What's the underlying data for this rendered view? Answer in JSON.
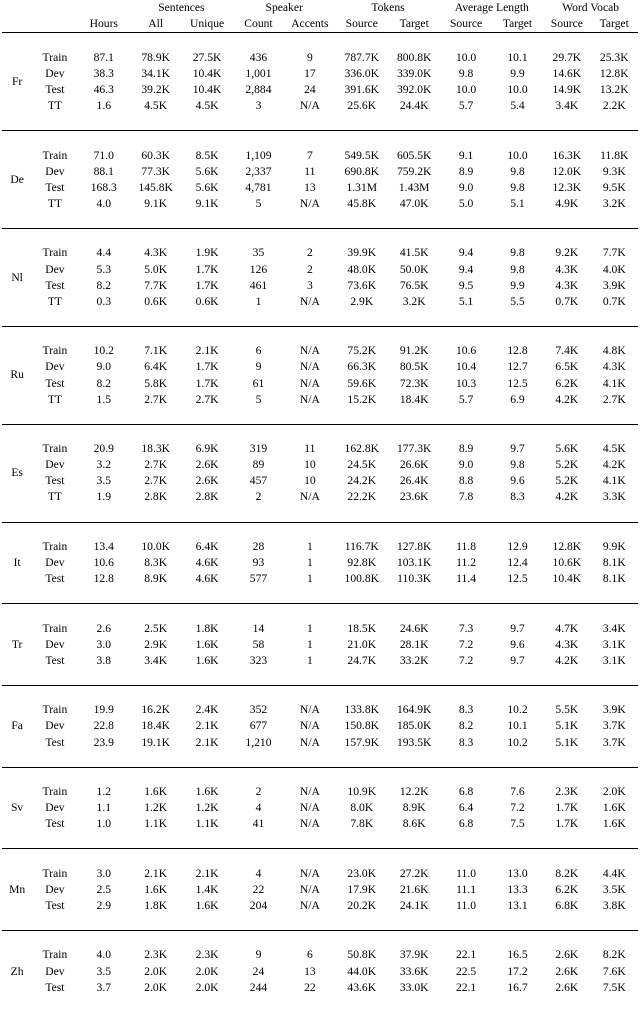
{
  "table": {
    "caption": "",
    "group_headers": [
      {
        "label": "",
        "span": 2
      },
      {
        "label": "",
        "span": 1
      },
      {
        "label": "Sentences",
        "span": 2
      },
      {
        "label": "Speaker",
        "span": 2
      },
      {
        "label": "Tokens",
        "span": 2
      },
      {
        "label": "Average Length",
        "span": 2
      },
      {
        "label": "Word Vocab",
        "span": 2
      }
    ],
    "sub_headers": [
      "",
      "",
      "Hours",
      "All",
      "Unique",
      "Count",
      "Accents",
      "Source",
      "Target",
      "Source",
      "Target",
      "Source",
      "Target"
    ],
    "groups": [
      {
        "lang": "Fr",
        "rows": [
          {
            "split": "Train",
            "hours": "87.1",
            "sent_all": "78.9K",
            "sent_uniq": "27.5K",
            "spk_count": "436",
            "spk_accents": "9",
            "tok_src": "787.7K",
            "tok_tgt": "800.8K",
            "avg_src": "10.0",
            "avg_tgt": "10.1",
            "voc_src": "29.7K",
            "voc_tgt": "25.3K"
          },
          {
            "split": "Dev",
            "hours": "38.3",
            "sent_all": "34.1K",
            "sent_uniq": "10.4K",
            "spk_count": "1,001",
            "spk_accents": "17",
            "tok_src": "336.0K",
            "tok_tgt": "339.0K",
            "avg_src": "9.8",
            "avg_tgt": "9.9",
            "voc_src": "14.6K",
            "voc_tgt": "12.8K"
          },
          {
            "split": "Test",
            "hours": "46.3",
            "sent_all": "39.2K",
            "sent_uniq": "10.4K",
            "spk_count": "2,884",
            "spk_accents": "24",
            "tok_src": "391.6K",
            "tok_tgt": "392.0K",
            "avg_src": "10.0",
            "avg_tgt": "10.0",
            "voc_src": "14.9K",
            "voc_tgt": "13.2K"
          },
          {
            "split": "TT",
            "hours": "1.6",
            "sent_all": "4.5K",
            "sent_uniq": "4.5K",
            "spk_count": "3",
            "spk_accents": "N/A",
            "tok_src": "25.6K",
            "tok_tgt": "24.4K",
            "avg_src": "5.7",
            "avg_tgt": "5.4",
            "voc_src": "3.4K",
            "voc_tgt": "2.2K"
          }
        ]
      },
      {
        "lang": "De",
        "rows": [
          {
            "split": "Train",
            "hours": "71.0",
            "sent_all": "60.3K",
            "sent_uniq": "8.5K",
            "spk_count": "1,109",
            "spk_accents": "7",
            "tok_src": "549.5K",
            "tok_tgt": "605.5K",
            "avg_src": "9.1",
            "avg_tgt": "10.0",
            "voc_src": "16.3K",
            "voc_tgt": "11.8K"
          },
          {
            "split": "Dev",
            "hours": "88.1",
            "sent_all": "77.3K",
            "sent_uniq": "5.6K",
            "spk_count": "2,337",
            "spk_accents": "11",
            "tok_src": "690.8K",
            "tok_tgt": "759.2K",
            "avg_src": "8.9",
            "avg_tgt": "9.8",
            "voc_src": "12.0K",
            "voc_tgt": "9.3K"
          },
          {
            "split": "Test",
            "hours": "168.3",
            "sent_all": "145.8K",
            "sent_uniq": "5.6K",
            "spk_count": "4,781",
            "spk_accents": "13",
            "tok_src": "1.31M",
            "tok_tgt": "1.43M",
            "avg_src": "9.0",
            "avg_tgt": "9.8",
            "voc_src": "12.3K",
            "voc_tgt": "9.5K"
          },
          {
            "split": "TT",
            "hours": "4.0",
            "sent_all": "9.1K",
            "sent_uniq": "9.1K",
            "spk_count": "5",
            "spk_accents": "N/A",
            "tok_src": "45.8K",
            "tok_tgt": "47.0K",
            "avg_src": "5.0",
            "avg_tgt": "5.1",
            "voc_src": "4.9K",
            "voc_tgt": "3.2K"
          }
        ]
      },
      {
        "lang": "Nl",
        "rows": [
          {
            "split": "Train",
            "hours": "4.4",
            "sent_all": "4.3K",
            "sent_uniq": "1.9K",
            "spk_count": "35",
            "spk_accents": "2",
            "tok_src": "39.9K",
            "tok_tgt": "41.5K",
            "avg_src": "9.4",
            "avg_tgt": "9.8",
            "voc_src": "9.2K",
            "voc_tgt": "7.7K"
          },
          {
            "split": "Dev",
            "hours": "5.3",
            "sent_all": "5.0K",
            "sent_uniq": "1.7K",
            "spk_count": "126",
            "spk_accents": "2",
            "tok_src": "48.0K",
            "tok_tgt": "50.0K",
            "avg_src": "9.4",
            "avg_tgt": "9.8",
            "voc_src": "4.3K",
            "voc_tgt": "4.0K"
          },
          {
            "split": "Test",
            "hours": "8.2",
            "sent_all": "7.7K",
            "sent_uniq": "1.7K",
            "spk_count": "461",
            "spk_accents": "3",
            "tok_src": "73.6K",
            "tok_tgt": "76.5K",
            "avg_src": "9.5",
            "avg_tgt": "9.9",
            "voc_src": "4.3K",
            "voc_tgt": "3.9K"
          },
          {
            "split": "TT",
            "hours": "0.3",
            "sent_all": "0.6K",
            "sent_uniq": "0.6K",
            "spk_count": "1",
            "spk_accents": "N/A",
            "tok_src": "2.9K",
            "tok_tgt": "3.2K",
            "avg_src": "5.1",
            "avg_tgt": "5.5",
            "voc_src": "0.7K",
            "voc_tgt": "0.7K"
          }
        ]
      },
      {
        "lang": "Ru",
        "rows": [
          {
            "split": "Train",
            "hours": "10.2",
            "sent_all": "7.1K",
            "sent_uniq": "2.1K",
            "spk_count": "6",
            "spk_accents": "N/A",
            "tok_src": "75.2K",
            "tok_tgt": "91.2K",
            "avg_src": "10.6",
            "avg_tgt": "12.8",
            "voc_src": "7.4K",
            "voc_tgt": "4.8K"
          },
          {
            "split": "Dev",
            "hours": "9.0",
            "sent_all": "6.4K",
            "sent_uniq": "1.7K",
            "spk_count": "9",
            "spk_accents": "N/A",
            "tok_src": "66.3K",
            "tok_tgt": "80.5K",
            "avg_src": "10.4",
            "avg_tgt": "12.7",
            "voc_src": "6.5K",
            "voc_tgt": "4.3K"
          },
          {
            "split": "Test",
            "hours": "8.2",
            "sent_all": "5.8K",
            "sent_uniq": "1.7K",
            "spk_count": "61",
            "spk_accents": "N/A",
            "tok_src": "59.6K",
            "tok_tgt": "72.3K",
            "avg_src": "10.3",
            "avg_tgt": "12.5",
            "voc_src": "6.2K",
            "voc_tgt": "4.1K"
          },
          {
            "split": "TT",
            "hours": "1.5",
            "sent_all": "2.7K",
            "sent_uniq": "2.7K",
            "spk_count": "5",
            "spk_accents": "N/A",
            "tok_src": "15.2K",
            "tok_tgt": "18.4K",
            "avg_src": "5.7",
            "avg_tgt": "6.9",
            "voc_src": "4.2K",
            "voc_tgt": "2.7K"
          }
        ]
      },
      {
        "lang": "Es",
        "rows": [
          {
            "split": "Train",
            "hours": "20.9",
            "sent_all": "18.3K",
            "sent_uniq": "6.9K",
            "spk_count": "319",
            "spk_accents": "11",
            "tok_src": "162.8K",
            "tok_tgt": "177.3K",
            "avg_src": "8.9",
            "avg_tgt": "9.7",
            "voc_src": "5.6K",
            "voc_tgt": "4.5K"
          },
          {
            "split": "Dev",
            "hours": "3.2",
            "sent_all": "2.7K",
            "sent_uniq": "2.6K",
            "spk_count": "89",
            "spk_accents": "10",
            "tok_src": "24.5K",
            "tok_tgt": "26.6K",
            "avg_src": "9.0",
            "avg_tgt": "9.8",
            "voc_src": "5.2K",
            "voc_tgt": "4.2K"
          },
          {
            "split": "Test",
            "hours": "3.5",
            "sent_all": "2.7K",
            "sent_uniq": "2.6K",
            "spk_count": "457",
            "spk_accents": "10",
            "tok_src": "24.2K",
            "tok_tgt": "26.4K",
            "avg_src": "8.8",
            "avg_tgt": "9.6",
            "voc_src": "5.2K",
            "voc_tgt": "4.1K"
          },
          {
            "split": "TT",
            "hours": "1.9",
            "sent_all": "2.8K",
            "sent_uniq": "2.8K",
            "spk_count": "2",
            "spk_accents": "N/A",
            "tok_src": "22.2K",
            "tok_tgt": "23.6K",
            "avg_src": "7.8",
            "avg_tgt": "8.3",
            "voc_src": "4.2K",
            "voc_tgt": "3.3K"
          }
        ]
      },
      {
        "lang": "It",
        "rows": [
          {
            "split": "Train",
            "hours": "13.4",
            "sent_all": "10.0K",
            "sent_uniq": "6.4K",
            "spk_count": "28",
            "spk_accents": "1",
            "tok_src": "116.7K",
            "tok_tgt": "127.8K",
            "avg_src": "11.8",
            "avg_tgt": "12.9",
            "voc_src": "12.8K",
            "voc_tgt": "9.9K"
          },
          {
            "split": "Dev",
            "hours": "10.6",
            "sent_all": "8.3K",
            "sent_uniq": "4.6K",
            "spk_count": "93",
            "spk_accents": "1",
            "tok_src": "92.8K",
            "tok_tgt": "103.1K",
            "avg_src": "11.2",
            "avg_tgt": "12.4",
            "voc_src": "10.6K",
            "voc_tgt": "8.1K"
          },
          {
            "split": "Test",
            "hours": "12.8",
            "sent_all": "8.9K",
            "sent_uniq": "4.6K",
            "spk_count": "577",
            "spk_accents": "1",
            "tok_src": "100.8K",
            "tok_tgt": "110.3K",
            "avg_src": "11.4",
            "avg_tgt": "12.5",
            "voc_src": "10.4K",
            "voc_tgt": "8.1K"
          }
        ]
      },
      {
        "lang": "Tr",
        "rows": [
          {
            "split": "Train",
            "hours": "2.6",
            "sent_all": "2.5K",
            "sent_uniq": "1.8K",
            "spk_count": "14",
            "spk_accents": "1",
            "tok_src": "18.5K",
            "tok_tgt": "24.6K",
            "avg_src": "7.3",
            "avg_tgt": "9.7",
            "voc_src": "4.7K",
            "voc_tgt": "3.4K"
          },
          {
            "split": "Dev",
            "hours": "3.0",
            "sent_all": "2.9K",
            "sent_uniq": "1.6K",
            "spk_count": "58",
            "spk_accents": "1",
            "tok_src": "21.0K",
            "tok_tgt": "28.1K",
            "avg_src": "7.2",
            "avg_tgt": "9.6",
            "voc_src": "4.3K",
            "voc_tgt": "3.1K"
          },
          {
            "split": "Test",
            "hours": "3.8",
            "sent_all": "3.4K",
            "sent_uniq": "1.6K",
            "spk_count": "323",
            "spk_accents": "1",
            "tok_src": "24.7K",
            "tok_tgt": "33.2K",
            "avg_src": "7.2",
            "avg_tgt": "9.7",
            "voc_src": "4.2K",
            "voc_tgt": "3.1K"
          }
        ]
      },
      {
        "lang": "Fa",
        "rows": [
          {
            "split": "Train",
            "hours": "19.9",
            "sent_all": "16.2K",
            "sent_uniq": "2.4K",
            "spk_count": "352",
            "spk_accents": "N/A",
            "tok_src": "133.8K",
            "tok_tgt": "164.9K",
            "avg_src": "8.3",
            "avg_tgt": "10.2",
            "voc_src": "5.5K",
            "voc_tgt": "3.9K"
          },
          {
            "split": "Dev",
            "hours": "22.8",
            "sent_all": "18.4K",
            "sent_uniq": "2.1K",
            "spk_count": "677",
            "spk_accents": "N/A",
            "tok_src": "150.8K",
            "tok_tgt": "185.0K",
            "avg_src": "8.2",
            "avg_tgt": "10.1",
            "voc_src": "5.1K",
            "voc_tgt": "3.7K"
          },
          {
            "split": "Test",
            "hours": "23.9",
            "sent_all": "19.1K",
            "sent_uniq": "2.1K",
            "spk_count": "1,210",
            "spk_accents": "N/A",
            "tok_src": "157.9K",
            "tok_tgt": "193.5K",
            "avg_src": "8.3",
            "avg_tgt": "10.2",
            "voc_src": "5.1K",
            "voc_tgt": "3.7K"
          }
        ]
      },
      {
        "lang": "Sv",
        "rows": [
          {
            "split": "Train",
            "hours": "1.2",
            "sent_all": "1.6K",
            "sent_uniq": "1.6K",
            "spk_count": "2",
            "spk_accents": "N/A",
            "tok_src": "10.9K",
            "tok_tgt": "12.2K",
            "avg_src": "6.8",
            "avg_tgt": "7.6",
            "voc_src": "2.3K",
            "voc_tgt": "2.0K"
          },
          {
            "split": "Dev",
            "hours": "1.1",
            "sent_all": "1.2K",
            "sent_uniq": "1.2K",
            "spk_count": "4",
            "spk_accents": "N/A",
            "tok_src": "8.0K",
            "tok_tgt": "8.9K",
            "avg_src": "6.4",
            "avg_tgt": "7.2",
            "voc_src": "1.7K",
            "voc_tgt": "1.6K"
          },
          {
            "split": "Test",
            "hours": "1.0",
            "sent_all": "1.1K",
            "sent_uniq": "1.1K",
            "spk_count": "41",
            "spk_accents": "N/A",
            "tok_src": "7.8K",
            "tok_tgt": "8.6K",
            "avg_src": "6.8",
            "avg_tgt": "7.5",
            "voc_src": "1.7K",
            "voc_tgt": "1.6K"
          }
        ]
      },
      {
        "lang": "Mn",
        "rows": [
          {
            "split": "Train",
            "hours": "3.0",
            "sent_all": "2.1K",
            "sent_uniq": "2.1K",
            "spk_count": "4",
            "spk_accents": "N/A",
            "tok_src": "23.0K",
            "tok_tgt": "27.2K",
            "avg_src": "11.0",
            "avg_tgt": "13.0",
            "voc_src": "8.2K",
            "voc_tgt": "4.4K"
          },
          {
            "split": "Dev",
            "hours": "2.5",
            "sent_all": "1.6K",
            "sent_uniq": "1.4K",
            "spk_count": "22",
            "spk_accents": "N/A",
            "tok_src": "17.9K",
            "tok_tgt": "21.6K",
            "avg_src": "11.1",
            "avg_tgt": "13.3",
            "voc_src": "6.2K",
            "voc_tgt": "3.5K"
          },
          {
            "split": "Test",
            "hours": "2.9",
            "sent_all": "1.8K",
            "sent_uniq": "1.6K",
            "spk_count": "204",
            "spk_accents": "N/A",
            "tok_src": "20.2K",
            "tok_tgt": "24.1K",
            "avg_src": "11.0",
            "avg_tgt": "13.1",
            "voc_src": "6.8K",
            "voc_tgt": "3.8K"
          }
        ]
      },
      {
        "lang": "Zh",
        "rows": [
          {
            "split": "Train",
            "hours": "4.0",
            "sent_all": "2.3K",
            "sent_uniq": "2.3K",
            "spk_count": "9",
            "spk_accents": "6",
            "tok_src": "50.8K",
            "tok_tgt": "37.9K",
            "avg_src": "22.1",
            "avg_tgt": "16.5",
            "voc_src": "2.6K",
            "voc_tgt": "8.2K"
          },
          {
            "split": "Dev",
            "hours": "3.5",
            "sent_all": "2.0K",
            "sent_uniq": "2.0K",
            "spk_count": "24",
            "spk_accents": "13",
            "tok_src": "44.0K",
            "tok_tgt": "33.6K",
            "avg_src": "22.5",
            "avg_tgt": "17.2",
            "voc_src": "2.6K",
            "voc_tgt": "7.6K"
          },
          {
            "split": "Test",
            "hours": "3.7",
            "sent_all": "2.0K",
            "sent_uniq": "2.0K",
            "spk_count": "244",
            "spk_accents": "22",
            "tok_src": "43.6K",
            "tok_tgt": "33.0K",
            "avg_src": "22.1",
            "avg_tgt": "16.7",
            "voc_src": "2.6K",
            "voc_tgt": "7.5K"
          }
        ]
      }
    ]
  }
}
